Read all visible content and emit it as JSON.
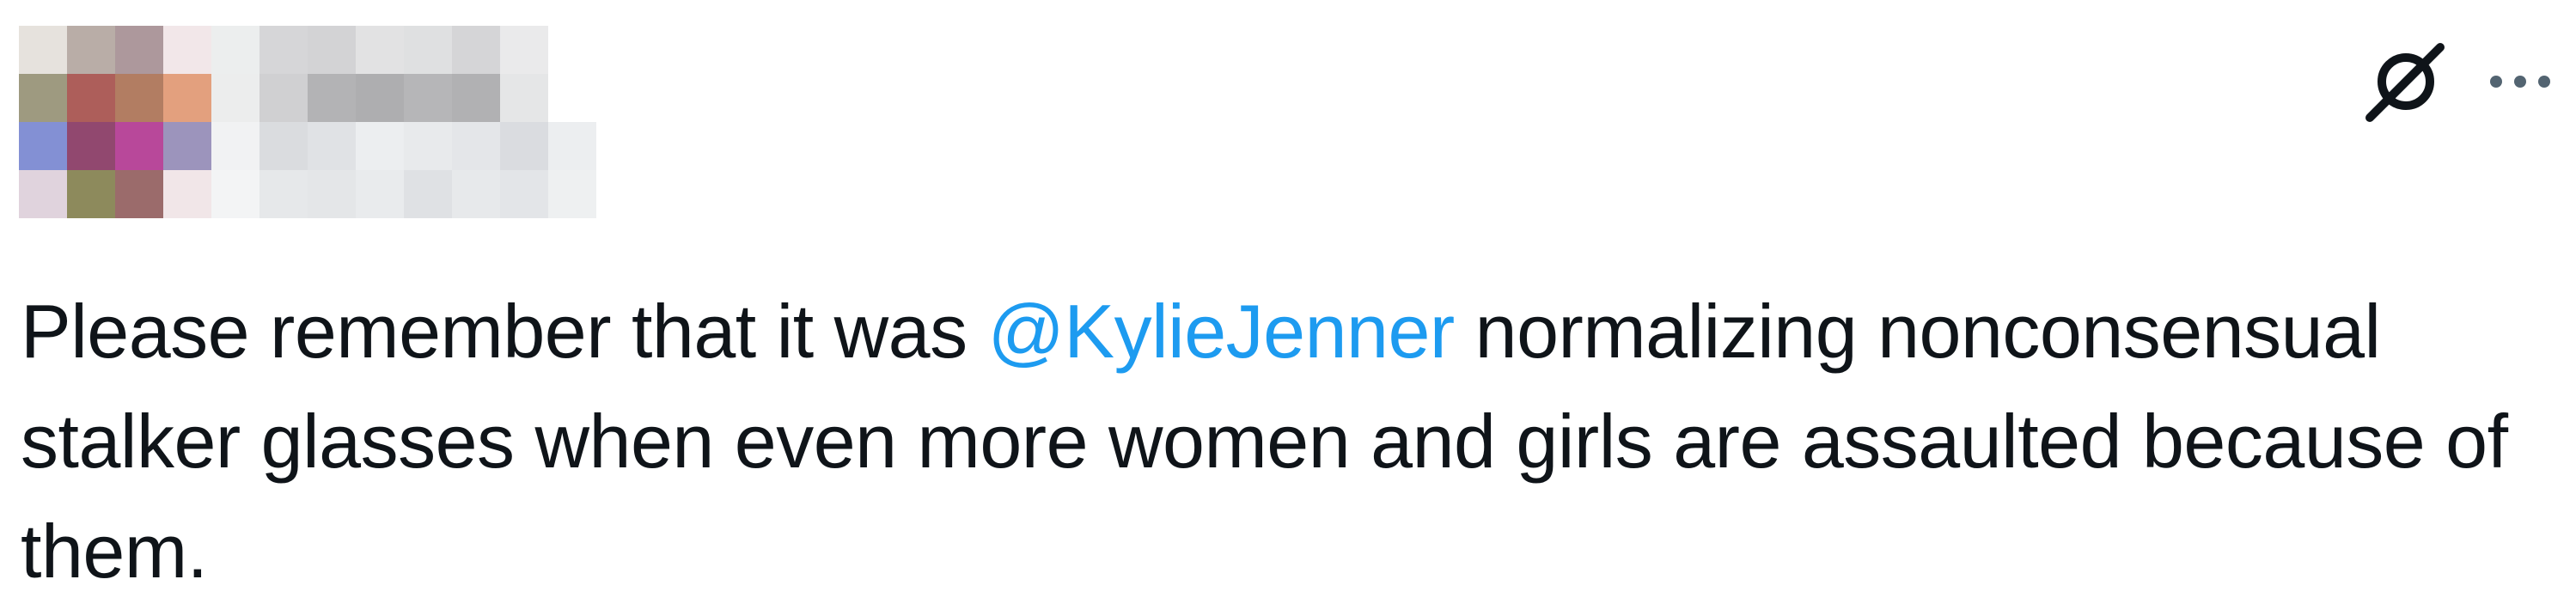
{
  "tweet": {
    "text_before": "Please remember that it was ",
    "mention": "@KylieJenner",
    "text_after": " normalizing nonconsensual stalker glasses when even more women and girls are assaulted because of them.",
    "actions": {
      "grok_icon": "grok-icon",
      "more_icon": "more-icon"
    }
  },
  "colors": {
    "mention": "#1d9bf0",
    "text": "#0f1419",
    "icon": "#536471"
  }
}
